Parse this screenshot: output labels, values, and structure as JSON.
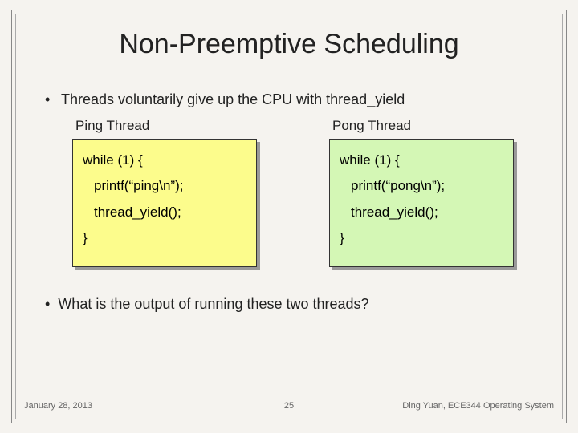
{
  "title": "Non-Preemptive Scheduling",
  "bullet1": "Threads voluntarily give up the CPU with thread_yield",
  "ping": {
    "label": "Ping Thread",
    "line1": "while (1) {",
    "line2": "printf(“ping\\n”);",
    "line3": "thread_yield();",
    "line4": "}"
  },
  "pong": {
    "label": "Pong Thread",
    "line1": "while (1) {",
    "line2": "printf(“pong\\n”);",
    "line3": "thread_yield();",
    "line4": "}"
  },
  "bullet2": "What is the output of running these two threads?",
  "footer": {
    "left": "January 28, 2013",
    "center": "25",
    "right": "Ding Yuan, ECE344 Operating System"
  }
}
